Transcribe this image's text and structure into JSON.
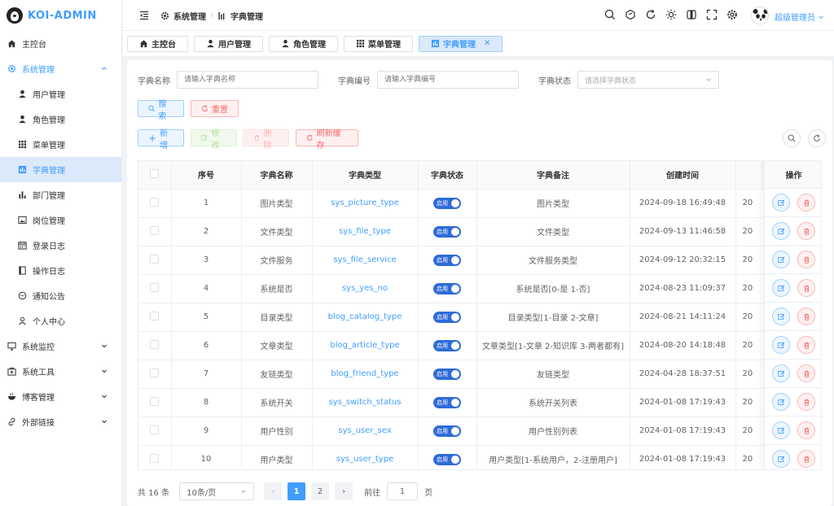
{
  "app": {
    "title": "KOI-ADMIN"
  },
  "sidebar": {
    "items": [
      {
        "label": "主控台",
        "icon": "home-icon"
      },
      {
        "label": "系统管理",
        "icon": "gear-icon"
      },
      {
        "label": "用户管理",
        "icon": "user-icon"
      },
      {
        "label": "角色管理",
        "icon": "user-icon"
      },
      {
        "label": "菜单管理",
        "icon": "grid-icon"
      },
      {
        "label": "字典管理",
        "icon": "chart-icon"
      },
      {
        "label": "部门管理",
        "icon": "bar-chart-icon"
      },
      {
        "label": "岗位管理",
        "icon": "image-icon"
      },
      {
        "label": "登录日志",
        "icon": "calendar-icon"
      },
      {
        "label": "操作日志",
        "icon": "document-icon"
      },
      {
        "label": "通知公告",
        "icon": "chat-icon"
      },
      {
        "label": "个人中心",
        "icon": "user-outline-icon"
      },
      {
        "label": "系统监控",
        "icon": "monitor-icon"
      },
      {
        "label": "系统工具",
        "icon": "toolbox-icon"
      },
      {
        "label": "博客管理",
        "icon": "bowl-icon"
      },
      {
        "label": "外部链接",
        "icon": "link-icon"
      }
    ]
  },
  "header": {
    "breadcrumb": [
      "系统管理",
      "字典管理"
    ],
    "user_name": "超级管理员"
  },
  "tabs": [
    {
      "label": "主控台"
    },
    {
      "label": "用户管理"
    },
    {
      "label": "角色管理"
    },
    {
      "label": "菜单管理"
    },
    {
      "label": "字典管理",
      "active": true
    }
  ],
  "filters": {
    "name_label": "字典名称",
    "name_placeholder": "请输入字典名称",
    "code_label": "字典编号",
    "code_placeholder": "请输入字典编号",
    "status_label": "字典状态",
    "status_placeholder": "请选择字典状态",
    "search": "搜索",
    "reset": "重置"
  },
  "toolbar": {
    "add": "新增",
    "edit": "修改",
    "delete": "删除",
    "refresh_cache": "刷新缓存"
  },
  "table": {
    "headers": [
      "序号",
      "字典名称",
      "字典类型",
      "字典状态",
      "字典备注",
      "创建时间",
      "操作"
    ],
    "trailing_col_value": "20",
    "rows": [
      {
        "no": "1",
        "name": "图片类型",
        "type": "sys_picture_type",
        "status": "启用",
        "remark": "图片类型",
        "created": "2024-09-18 16:49:48"
      },
      {
        "no": "2",
        "name": "文件类型",
        "type": "sys_file_type",
        "status": "启用",
        "remark": "文件类型",
        "created": "2024-09-13 11:46:58"
      },
      {
        "no": "3",
        "name": "文件服务",
        "type": "sys_file_service",
        "status": "启用",
        "remark": "文件服务类型",
        "created": "2024-09-12 20:32:15"
      },
      {
        "no": "4",
        "name": "系统是否",
        "type": "sys_yes_no",
        "status": "启用",
        "remark": "系统是否[0-是 1-否]",
        "created": "2024-08-23 11:09:37"
      },
      {
        "no": "5",
        "name": "目录类型",
        "type": "blog_catalog_type",
        "status": "启用",
        "remark": "目录类型[1-目录 2-文章]",
        "created": "2024-08-21 14:11:24"
      },
      {
        "no": "6",
        "name": "文章类型",
        "type": "blog_article_type",
        "status": "启用",
        "remark": "文章类型[1-文章 2-知识库 3-两者都有]",
        "created": "2024-08-20 14:18:48"
      },
      {
        "no": "7",
        "name": "友链类型",
        "type": "blog_friend_type",
        "status": "启用",
        "remark": "友链类型",
        "created": "2024-04-28 18:37:51"
      },
      {
        "no": "8",
        "name": "系统开关",
        "type": "sys_switch_status",
        "status": "启用",
        "remark": "系统开关列表",
        "created": "2024-01-08 17:19:43"
      },
      {
        "no": "9",
        "name": "用户性别",
        "type": "sys_user_sex",
        "status": "启用",
        "remark": "用户性别列表",
        "created": "2024-01-08 17:19:43"
      },
      {
        "no": "10",
        "name": "用户类型",
        "type": "sys_user_type",
        "status": "启用",
        "remark": "用户类型[1-系统用户，2-注册用户]",
        "created": "2024-01-08 17:19:43"
      }
    ]
  },
  "pagination": {
    "total": "共 16 条",
    "page_size": "10条/页",
    "pages": [
      "1",
      "2"
    ],
    "current": "1",
    "goto_label": "前往",
    "goto_value": "1",
    "page_suffix": "页"
  }
}
